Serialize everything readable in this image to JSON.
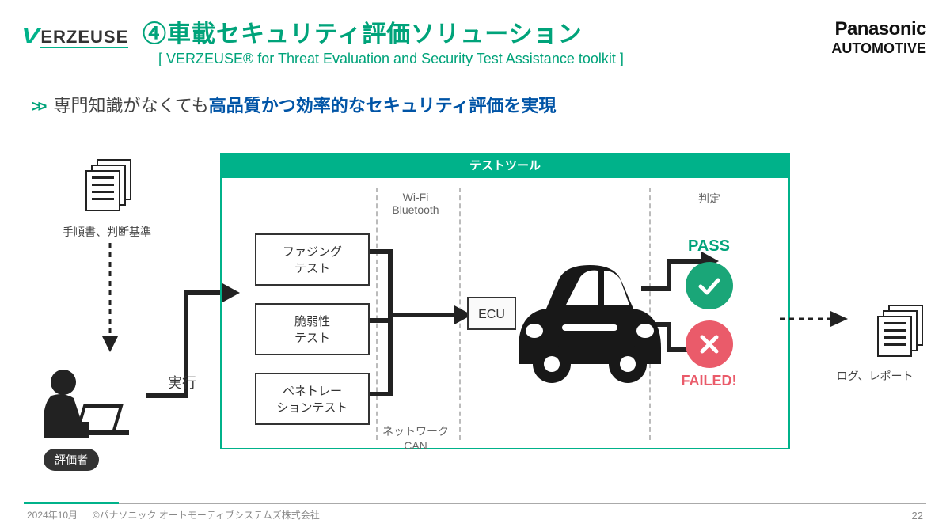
{
  "brand": {
    "verzeuse": "ERZEUSE",
    "pana1": "Panasonic",
    "pana2": "AUTOMOTIVE"
  },
  "title": "④車載セキュリティ評価ソリューション",
  "subtitle": "[ VERZEUSE® for Threat Evaluation and Security Test Assistance toolkit ]",
  "lead": {
    "k1": "専門知識がなくても",
    "k2": "高品質かつ効率的なセキュリティ評価を実現"
  },
  "docs_label": "手順書、判断基準",
  "evaluator_label": "評価者",
  "exec_label": "実行",
  "panel_title": "テストツール",
  "wifi": {
    "l1": "Wi-Fi",
    "l2": "Bluetooth"
  },
  "net": {
    "l1": "ネットワーク",
    "l2": "CAN"
  },
  "tests": {
    "t1": "ファジング\nテスト",
    "t2": "脆弱性\nテスト",
    "t3": "ペネトレー\nションテスト"
  },
  "ecu": "ECU",
  "judge_label": "判定",
  "pass": "PASS",
  "fail": "FAILED!",
  "logs_label": "ログ、レポート",
  "footer": "2024年10月 ｜ ©パナソニック オートモーティブシステムズ株式会社",
  "pagenum": "22"
}
